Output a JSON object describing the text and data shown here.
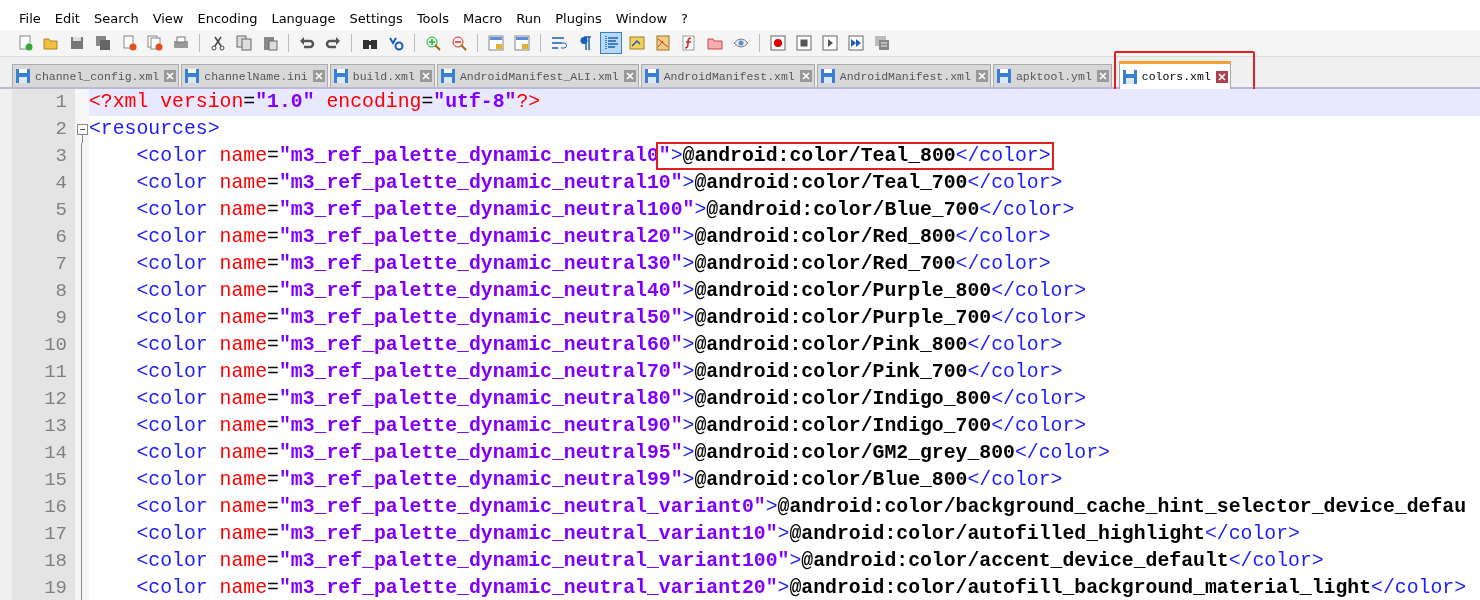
{
  "menu": [
    "File",
    "Edit",
    "Search",
    "View",
    "Encoding",
    "Language",
    "Settings",
    "Tools",
    "Macro",
    "Run",
    "Plugins",
    "Window",
    "?"
  ],
  "toolbar": [
    {
      "items": [
        {
          "kind": "new",
          "on": false
        },
        {
          "kind": "open",
          "on": false
        },
        {
          "kind": "save",
          "on": false
        },
        {
          "kind": "saveall",
          "on": false
        },
        {
          "kind": "close",
          "on": false
        },
        {
          "kind": "closeall",
          "on": false
        },
        {
          "kind": "print",
          "on": false
        }
      ]
    },
    {
      "items": [
        {
          "kind": "cut",
          "on": false
        },
        {
          "kind": "copy",
          "on": false
        },
        {
          "kind": "paste",
          "on": false
        }
      ]
    },
    {
      "items": [
        {
          "kind": "undo",
          "on": false
        },
        {
          "kind": "redo",
          "on": false
        }
      ]
    },
    {
      "items": [
        {
          "kind": "find",
          "on": false
        },
        {
          "kind": "replace",
          "on": false
        }
      ]
    },
    {
      "items": [
        {
          "kind": "zoomin",
          "on": false
        },
        {
          "kind": "zoomout",
          "on": false
        }
      ]
    },
    {
      "items": [
        {
          "kind": "syncv",
          "on": false
        },
        {
          "kind": "synch",
          "on": false
        }
      ]
    },
    {
      "items": [
        {
          "kind": "wrap",
          "on": false
        },
        {
          "kind": "pilcrow",
          "on": false
        },
        {
          "kind": "indent",
          "on": true
        },
        {
          "kind": "udl",
          "on": false
        },
        {
          "kind": "map",
          "on": false
        },
        {
          "kind": "func",
          "on": false
        },
        {
          "kind": "folder",
          "on": false
        },
        {
          "kind": "eye",
          "on": false
        }
      ]
    },
    {
      "items": [
        {
          "kind": "record",
          "on": false
        },
        {
          "kind": "stop",
          "on": false
        },
        {
          "kind": "play",
          "on": false
        },
        {
          "kind": "playmulti",
          "on": false
        },
        {
          "kind": "savemacro",
          "on": false
        }
      ]
    }
  ],
  "tabs": [
    {
      "label": "channel_config.xml",
      "selected": false,
      "annotated": false
    },
    {
      "label": "channelName.ini",
      "selected": false,
      "annotated": false
    },
    {
      "label": "build.xml",
      "selected": false,
      "annotated": false
    },
    {
      "label": "AndroidManifest_ALI.xml",
      "selected": false,
      "annotated": false
    },
    {
      "label": "AndroidManifest.xml",
      "selected": false,
      "annotated": false
    },
    {
      "label": "AndroidManifest.xml",
      "selected": false,
      "annotated": false
    },
    {
      "label": "apktool.yml",
      "selected": false,
      "annotated": false
    },
    {
      "label": "colors.xml",
      "selected": true,
      "annotated": true
    }
  ],
  "lines": [
    {
      "number": "1",
      "current": true,
      "indented": false,
      "fold": false,
      "tokens": [
        {
          "kind": "decl",
          "text": "<?xml version"
        },
        {
          "kind": "eq",
          "text": "="
        },
        {
          "kind": "val",
          "text": "\"1.0\""
        },
        {
          "kind": "decl",
          "text": " encoding"
        },
        {
          "kind": "eq",
          "text": "="
        },
        {
          "kind": "val",
          "text": "\"utf-8\""
        },
        {
          "kind": "decl",
          "text": "?>"
        }
      ]
    },
    {
      "number": "2",
      "current": false,
      "indented": false,
      "fold": true,
      "tokens": [
        {
          "kind": "tag",
          "text": "<resources>"
        }
      ]
    },
    {
      "number": "3",
      "current": false,
      "indented": true,
      "fold": false,
      "tokens": [
        {
          "kind": "tag",
          "text": "<color"
        },
        {
          "kind": "attr",
          "text": " name"
        },
        {
          "kind": "eq",
          "text": "="
        },
        {
          "kind": "val",
          "text": "\"m3_ref_palette_dynamic_neutral0"
        },
        {
          "kind": "val",
          "text": "\"",
          "boxed": true
        },
        {
          "kind": "tag",
          "text": ">",
          "boxed": true
        },
        {
          "kind": "text",
          "text": "@android:color/Teal_800",
          "boxed": true
        },
        {
          "kind": "tag",
          "text": "</color>",
          "boxed": true
        }
      ]
    },
    {
      "number": "4",
      "current": false,
      "indented": true,
      "fold": false,
      "tokens": [
        {
          "kind": "tag",
          "text": "<color"
        },
        {
          "kind": "attr",
          "text": " name"
        },
        {
          "kind": "eq",
          "text": "="
        },
        {
          "kind": "val",
          "text": "\"m3_ref_palette_dynamic_neutral10\""
        },
        {
          "kind": "tag",
          "text": ">"
        },
        {
          "kind": "text",
          "text": "@android:color/Teal_700"
        },
        {
          "kind": "tag",
          "text": "</color>"
        }
      ]
    },
    {
      "number": "5",
      "current": false,
      "indented": true,
      "fold": false,
      "tokens": [
        {
          "kind": "tag",
          "text": "<color"
        },
        {
          "kind": "attr",
          "text": " name"
        },
        {
          "kind": "eq",
          "text": "="
        },
        {
          "kind": "val",
          "text": "\"m3_ref_palette_dynamic_neutral100\""
        },
        {
          "kind": "tag",
          "text": ">"
        },
        {
          "kind": "text",
          "text": "@android:color/Blue_700"
        },
        {
          "kind": "tag",
          "text": "</color>"
        }
      ]
    },
    {
      "number": "6",
      "current": false,
      "indented": true,
      "fold": false,
      "tokens": [
        {
          "kind": "tag",
          "text": "<color"
        },
        {
          "kind": "attr",
          "text": " name"
        },
        {
          "kind": "eq",
          "text": "="
        },
        {
          "kind": "val",
          "text": "\"m3_ref_palette_dynamic_neutral20\""
        },
        {
          "kind": "tag",
          "text": ">"
        },
        {
          "kind": "text",
          "text": "@android:color/Red_800"
        },
        {
          "kind": "tag",
          "text": "</color>"
        }
      ]
    },
    {
      "number": "7",
      "current": false,
      "indented": true,
      "fold": false,
      "tokens": [
        {
          "kind": "tag",
          "text": "<color"
        },
        {
          "kind": "attr",
          "text": " name"
        },
        {
          "kind": "eq",
          "text": "="
        },
        {
          "kind": "val",
          "text": "\"m3_ref_palette_dynamic_neutral30\""
        },
        {
          "kind": "tag",
          "text": ">"
        },
        {
          "kind": "text",
          "text": "@android:color/Red_700"
        },
        {
          "kind": "tag",
          "text": "</color>"
        }
      ]
    },
    {
      "number": "8",
      "current": false,
      "indented": true,
      "fold": false,
      "tokens": [
        {
          "kind": "tag",
          "text": "<color"
        },
        {
          "kind": "attr",
          "text": " name"
        },
        {
          "kind": "eq",
          "text": "="
        },
        {
          "kind": "val",
          "text": "\"m3_ref_palette_dynamic_neutral40\""
        },
        {
          "kind": "tag",
          "text": ">"
        },
        {
          "kind": "text",
          "text": "@android:color/Purple_800"
        },
        {
          "kind": "tag",
          "text": "</color>"
        }
      ]
    },
    {
      "number": "9",
      "current": false,
      "indented": true,
      "fold": false,
      "tokens": [
        {
          "kind": "tag",
          "text": "<color"
        },
        {
          "kind": "attr",
          "text": " name"
        },
        {
          "kind": "eq",
          "text": "="
        },
        {
          "kind": "val",
          "text": "\"m3_ref_palette_dynamic_neutral50\""
        },
        {
          "kind": "tag",
          "text": ">"
        },
        {
          "kind": "text",
          "text": "@android:color/Purple_700"
        },
        {
          "kind": "tag",
          "text": "</color>"
        }
      ]
    },
    {
      "number": "10",
      "current": false,
      "indented": true,
      "fold": false,
      "tokens": [
        {
          "kind": "tag",
          "text": "<color"
        },
        {
          "kind": "attr",
          "text": " name"
        },
        {
          "kind": "eq",
          "text": "="
        },
        {
          "kind": "val",
          "text": "\"m3_ref_palette_dynamic_neutral60\""
        },
        {
          "kind": "tag",
          "text": ">"
        },
        {
          "kind": "text",
          "text": "@android:color/Pink_800"
        },
        {
          "kind": "tag",
          "text": "</color>"
        }
      ]
    },
    {
      "number": "11",
      "current": false,
      "indented": true,
      "fold": false,
      "tokens": [
        {
          "kind": "tag",
          "text": "<color"
        },
        {
          "kind": "attr",
          "text": " name"
        },
        {
          "kind": "eq",
          "text": "="
        },
        {
          "kind": "val",
          "text": "\"m3_ref_palette_dynamic_neutral70\""
        },
        {
          "kind": "tag",
          "text": ">"
        },
        {
          "kind": "text",
          "text": "@android:color/Pink_700"
        },
        {
          "kind": "tag",
          "text": "</color>"
        }
      ]
    },
    {
      "number": "12",
      "current": false,
      "indented": true,
      "fold": false,
      "tokens": [
        {
          "kind": "tag",
          "text": "<color"
        },
        {
          "kind": "attr",
          "text": " name"
        },
        {
          "kind": "eq",
          "text": "="
        },
        {
          "kind": "val",
          "text": "\"m3_ref_palette_dynamic_neutral80\""
        },
        {
          "kind": "tag",
          "text": ">"
        },
        {
          "kind": "text",
          "text": "@android:color/Indigo_800"
        },
        {
          "kind": "tag",
          "text": "</color>"
        }
      ]
    },
    {
      "number": "13",
      "current": false,
      "indented": true,
      "fold": false,
      "tokens": [
        {
          "kind": "tag",
          "text": "<color"
        },
        {
          "kind": "attr",
          "text": " name"
        },
        {
          "kind": "eq",
          "text": "="
        },
        {
          "kind": "val",
          "text": "\"m3_ref_palette_dynamic_neutral90\""
        },
        {
          "kind": "tag",
          "text": ">"
        },
        {
          "kind": "text",
          "text": "@android:color/Indigo_700"
        },
        {
          "kind": "tag",
          "text": "</color>"
        }
      ]
    },
    {
      "number": "14",
      "current": false,
      "indented": true,
      "fold": false,
      "tokens": [
        {
          "kind": "tag",
          "text": "<color"
        },
        {
          "kind": "attr",
          "text": " name"
        },
        {
          "kind": "eq",
          "text": "="
        },
        {
          "kind": "val",
          "text": "\"m3_ref_palette_dynamic_neutral95\""
        },
        {
          "kind": "tag",
          "text": ">"
        },
        {
          "kind": "text",
          "text": "@android:color/GM2_grey_800"
        },
        {
          "kind": "tag",
          "text": "</color>"
        }
      ]
    },
    {
      "number": "15",
      "current": false,
      "indented": true,
      "fold": false,
      "tokens": [
        {
          "kind": "tag",
          "text": "<color"
        },
        {
          "kind": "attr",
          "text": " name"
        },
        {
          "kind": "eq",
          "text": "="
        },
        {
          "kind": "val",
          "text": "\"m3_ref_palette_dynamic_neutral99\""
        },
        {
          "kind": "tag",
          "text": ">"
        },
        {
          "kind": "text",
          "text": "@android:color/Blue_800"
        },
        {
          "kind": "tag",
          "text": "</color>"
        }
      ]
    },
    {
      "number": "16",
      "current": false,
      "indented": true,
      "fold": false,
      "tokens": [
        {
          "kind": "tag",
          "text": "<color"
        },
        {
          "kind": "attr",
          "text": " name"
        },
        {
          "kind": "eq",
          "text": "="
        },
        {
          "kind": "val",
          "text": "\"m3_ref_palette_dynamic_neutral_variant0\""
        },
        {
          "kind": "tag",
          "text": ">"
        },
        {
          "kind": "text",
          "text": "@android:color/background_cache_hint_selector_device_defau"
        }
      ]
    },
    {
      "number": "17",
      "current": false,
      "indented": true,
      "fold": false,
      "tokens": [
        {
          "kind": "tag",
          "text": "<color"
        },
        {
          "kind": "attr",
          "text": " name"
        },
        {
          "kind": "eq",
          "text": "="
        },
        {
          "kind": "val",
          "text": "\"m3_ref_palette_dynamic_neutral_variant10\""
        },
        {
          "kind": "tag",
          "text": ">"
        },
        {
          "kind": "text",
          "text": "@android:color/autofilled_highlight"
        },
        {
          "kind": "tag",
          "text": "</color>"
        }
      ]
    },
    {
      "number": "18",
      "current": false,
      "indented": true,
      "fold": false,
      "tokens": [
        {
          "kind": "tag",
          "text": "<color"
        },
        {
          "kind": "attr",
          "text": " name"
        },
        {
          "kind": "eq",
          "text": "="
        },
        {
          "kind": "val",
          "text": "\"m3_ref_palette_dynamic_neutral_variant100\""
        },
        {
          "kind": "tag",
          "text": ">"
        },
        {
          "kind": "text",
          "text": "@android:color/accent_device_default"
        },
        {
          "kind": "tag",
          "text": "</color>"
        }
      ]
    },
    {
      "number": "19",
      "current": false,
      "indented": true,
      "fold": false,
      "tokens": [
        {
          "kind": "tag",
          "text": "<color"
        },
        {
          "kind": "attr",
          "text": " name"
        },
        {
          "kind": "eq",
          "text": "="
        },
        {
          "kind": "val",
          "text": "\"m3_ref_palette_dynamic_neutral_variant20\""
        },
        {
          "kind": "tag",
          "text": ">"
        },
        {
          "kind": "text",
          "text": "@android:color/autofill_background_material_light"
        },
        {
          "kind": "tag",
          "text": "</color>"
        }
      ]
    }
  ]
}
